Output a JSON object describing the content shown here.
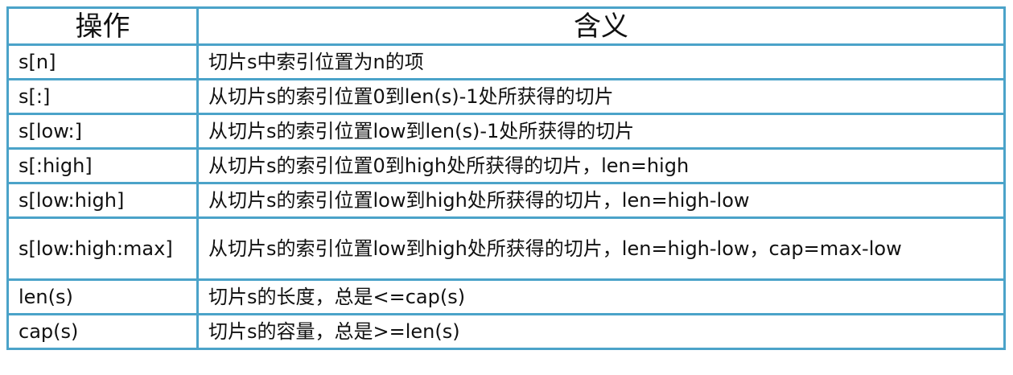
{
  "header": {
    "operation": "操作",
    "meaning": "含义"
  },
  "rows": [
    {
      "op": "s[n]",
      "desc": "切片s中索引位置为n的项"
    },
    {
      "op": "s[:]",
      "desc": "从切片s的索引位置0到len(s)-1处所获得的切片"
    },
    {
      "op": "s[low:]",
      "desc": "从切片s的索引位置low到len(s)-1处所获得的切片"
    },
    {
      "op": "s[:high]",
      "desc": "从切片s的索引位置0到high处所获得的切片，len=high"
    },
    {
      "op": "s[low:high]",
      "desc": "从切片s的索引位置low到high处所获得的切片，len=high-low"
    },
    {
      "op": "s[low:high:max]",
      "desc": "从切片s的索引位置low到high处所获得的切片，len=high-low，cap=max-low"
    },
    {
      "op": "len(s)",
      "desc": "切片s的长度，总是<=cap(s)"
    },
    {
      "op": "cap(s)",
      "desc": "切片s的容量，总是>=len(s)"
    }
  ]
}
